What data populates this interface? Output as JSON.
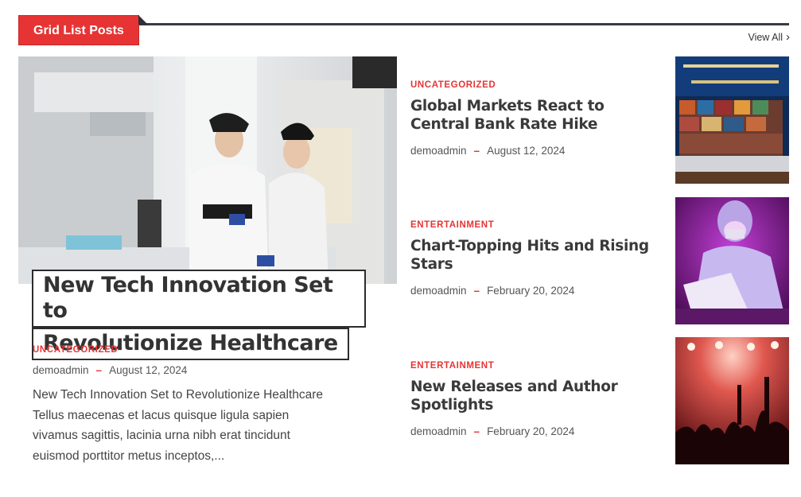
{
  "section": {
    "title": "Grid List Posts",
    "view_all": "View All"
  },
  "featured": {
    "title_line1": "New Tech Innovation Set to",
    "title_line2": "Revolutionize Healthcare",
    "category": "UNCATEGORIZED",
    "author": "demoadmin",
    "date": "August 12, 2024",
    "excerpt_lines": [
      "New Tech Innovation Set to Revolutionize Healthcare",
      "Tellus maecenas et lacus quisque ligula sapien",
      "vivamus sagittis, lacinia urna nibh erat tincidunt",
      "euismod porttitor metus inceptos,..."
    ]
  },
  "posts": [
    {
      "category": "UNCATEGORIZED",
      "title": "Global Markets React to Central Bank Rate Hike",
      "author": "demoadmin",
      "date": "August 12, 2024"
    },
    {
      "category": "ENTERTAINMENT",
      "title": "Chart-Topping Hits and Rising Stars",
      "author": "demoadmin",
      "date": "February 20, 2024"
    },
    {
      "category": "ENTERTAINMENT",
      "title": "New Releases and Author Spotlights",
      "author": "demoadmin",
      "date": "February 20, 2024"
    }
  ],
  "colors": {
    "accent": "#e63434",
    "text": "#333333"
  }
}
